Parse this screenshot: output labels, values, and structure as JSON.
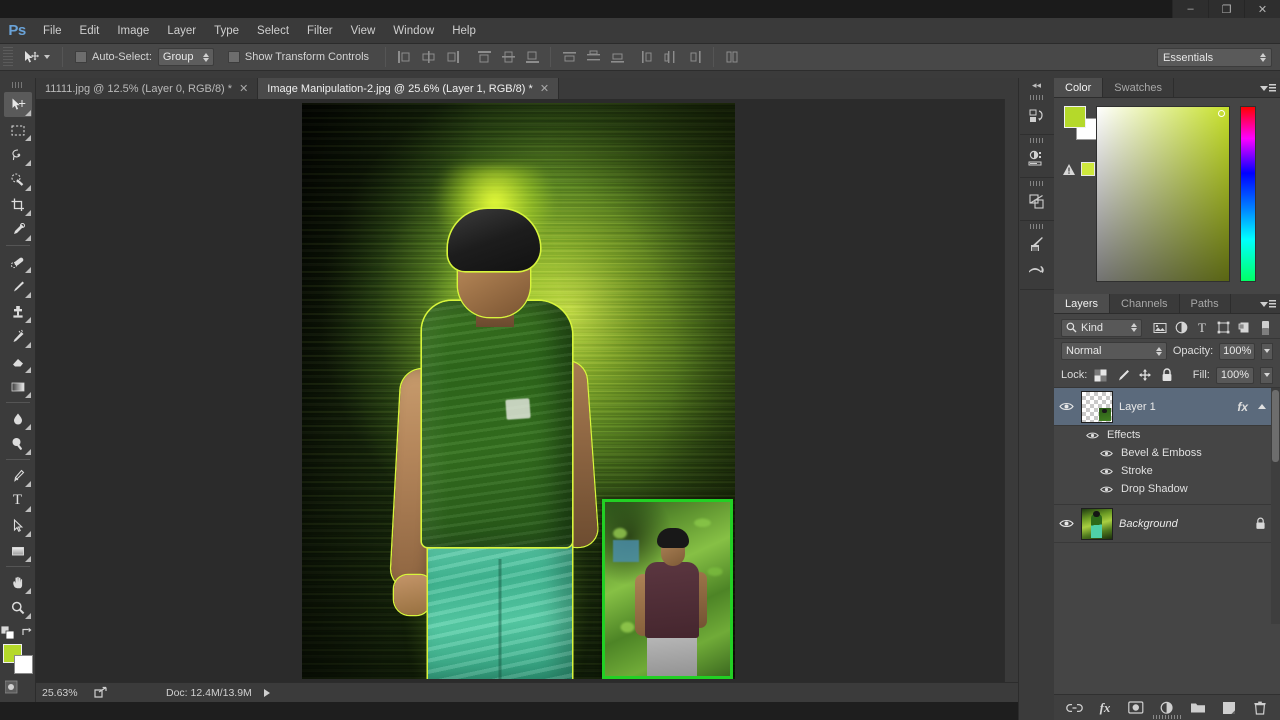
{
  "window": {
    "minimize_label": "–",
    "restore_label": "❐",
    "close_label": "✕"
  },
  "menubar": {
    "logo": "Ps",
    "items": [
      "File",
      "Edit",
      "Image",
      "Layer",
      "Type",
      "Select",
      "Filter",
      "View",
      "Window",
      "Help"
    ]
  },
  "options_bar": {
    "tool_icon": "move-tool-icon",
    "auto_select_label": "Auto-Select:",
    "auto_select_checked": false,
    "auto_select_value": "Group",
    "show_transform_label": "Show Transform Controls",
    "show_transform_checked": false,
    "align_icons": [
      "align-left-edges-icon",
      "align-horizontal-centers-icon",
      "align-right-edges-icon",
      "align-top-edges-icon",
      "align-vertical-centers-icon",
      "align-bottom-edges-icon"
    ],
    "distribute_icons": [
      "distribute-top-edges-icon",
      "distribute-vertical-centers-icon",
      "distribute-bottom-edges-icon",
      "distribute-left-edges-icon",
      "distribute-horizontal-centers-icon",
      "distribute-right-edges-icon"
    ],
    "extra_icon": "auto-align-layers-icon",
    "workspace": "Essentials"
  },
  "document_tabs": [
    {
      "title": "11111.jpg @ 12.5% (Layer 0, RGB/8) *",
      "active": false,
      "close": "✕"
    },
    {
      "title": "Image Manipulation-2.jpg @ 25.6% (Layer 1, RGB/8) *",
      "active": true,
      "close": "✕"
    }
  ],
  "toolbar": {
    "tools": [
      {
        "name": "move-tool",
        "selected": true
      },
      {
        "name": "rectangular-marquee-tool",
        "selected": false
      },
      {
        "name": "lasso-tool",
        "selected": false
      },
      {
        "name": "quick-selection-tool",
        "selected": false
      },
      {
        "name": "crop-tool",
        "selected": false
      },
      {
        "name": "eyedropper-tool",
        "selected": false
      },
      {
        "name": "spot-healing-brush-tool",
        "selected": false
      },
      {
        "name": "brush-tool",
        "selected": false
      },
      {
        "name": "clone-stamp-tool",
        "selected": false
      },
      {
        "name": "history-brush-tool",
        "selected": false
      },
      {
        "name": "eraser-tool",
        "selected": false
      },
      {
        "name": "gradient-tool",
        "selected": false
      },
      {
        "name": "blur-tool",
        "selected": false
      },
      {
        "name": "dodge-tool",
        "selected": false
      },
      {
        "name": "pen-tool",
        "selected": false
      },
      {
        "name": "horizontal-type-tool",
        "selected": false
      },
      {
        "name": "path-selection-tool",
        "selected": false
      },
      {
        "name": "rectangle-tool",
        "selected": false
      },
      {
        "name": "hand-tool",
        "selected": false
      },
      {
        "name": "zoom-tool",
        "selected": false
      }
    ],
    "foreground_color": "#b5d92a",
    "background_color": "#ffffff",
    "type_tool_label": "T"
  },
  "canvas": {
    "artwork_title": "Image Manipulation-2.jpg",
    "inset_border_color": "#22d024",
    "glow_color": "#d8f53c"
  },
  "status_bar": {
    "zoom": "25.63%",
    "share_icon": "share-icon",
    "doc_label": "Doc: 12.4M/13.9M",
    "arrow_icon": "play-arrow-icon"
  },
  "mini_dock": {
    "collapse_icon": "collapse-panels-icon",
    "groups": [
      [
        "history-panel-icon"
      ],
      [
        "adjustments-panel-icon"
      ],
      [
        "styles-panel-icon"
      ],
      [
        "brush-panel-icon",
        "brush-presets-panel-icon"
      ]
    ]
  },
  "color_panel": {
    "tabs": [
      {
        "label": "Color",
        "active": true
      },
      {
        "label": "Swatches",
        "active": false
      }
    ],
    "foreground_color": "#b5d92a",
    "background_color": "#ffffff",
    "out_of_gamut_icon": "gamut-warning-icon",
    "gamut_alt_color": "#cfe83d",
    "menu_icon": "panel-menu-icon"
  },
  "layers_panel": {
    "tabs": [
      {
        "label": "Layers",
        "active": true
      },
      {
        "label": "Channels",
        "active": false
      },
      {
        "label": "Paths",
        "active": false
      }
    ],
    "menu_icon": "panel-menu-icon",
    "filter_label": "Kind",
    "filter_search_icon": "search-icon",
    "filter_type_icons": [
      "filter-pixel-layers-icon",
      "filter-adjustment-layers-icon",
      "filter-type-layers-icon",
      "filter-shape-layers-icon",
      "filter-smart-object-icon"
    ],
    "filter_toggle_icon": "filter-toggle-icon",
    "blend_mode": "Normal",
    "opacity_label": "Opacity:",
    "opacity_value": "100%",
    "lock_label": "Lock:",
    "lock_icons": [
      "lock-transparent-pixels-icon",
      "lock-image-pixels-icon",
      "lock-position-icon",
      "lock-all-icon"
    ],
    "fill_label": "Fill:",
    "fill_value": "100%",
    "layers": [
      {
        "name": "Layer 1",
        "selected": true,
        "visible": true,
        "italic": false,
        "has_fx": true,
        "fx_label": "fx",
        "thumb": "transparent",
        "locked": false,
        "effects_label": "Effects",
        "effects": [
          "Bevel & Emboss",
          "Stroke",
          "Drop Shadow"
        ]
      },
      {
        "name": "Background",
        "selected": false,
        "visible": true,
        "italic": true,
        "has_fx": false,
        "thumb": "photo",
        "locked": true,
        "effects": []
      }
    ],
    "bottom_buttons": [
      "link-layers-icon",
      "add-layer-style-icon",
      "add-layer-mask-icon",
      "new-adjustment-layer-icon",
      "new-group-icon",
      "new-layer-icon",
      "delete-layer-icon"
    ]
  }
}
